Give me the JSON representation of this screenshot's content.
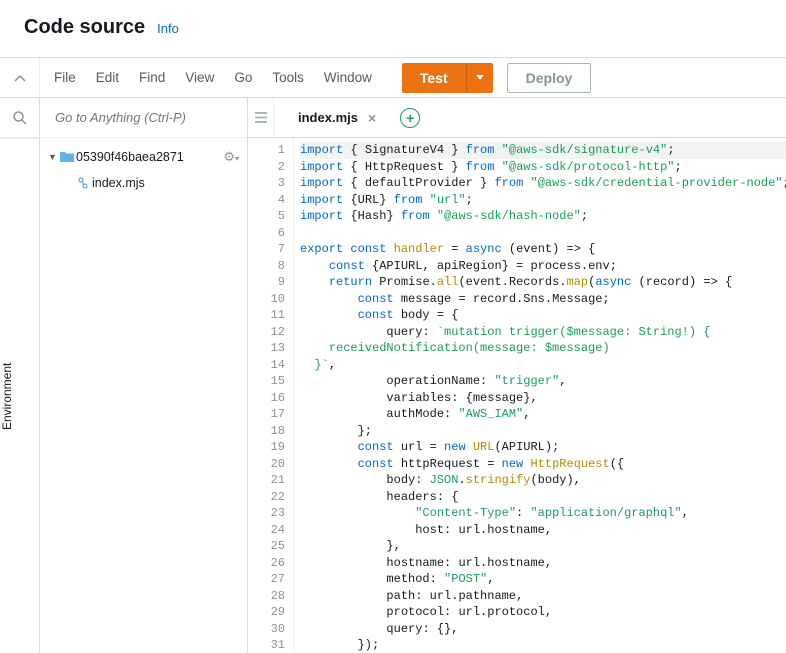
{
  "header": {
    "title": "Code source",
    "info": "Info"
  },
  "menu": {
    "file": "File",
    "edit": "Edit",
    "find": "Find",
    "view": "View",
    "go": "Go",
    "tools": "Tools",
    "window": "Window"
  },
  "buttons": {
    "test": "Test",
    "deploy": "Deploy"
  },
  "rail": {
    "environment": "Environment"
  },
  "search": {
    "placeholder": "Go to Anything (Ctrl-P)"
  },
  "tree": {
    "root": {
      "name": "05390f46baea2871"
    },
    "file": {
      "name": "index.mjs"
    }
  },
  "tab": {
    "name": "index.mjs"
  },
  "code": {
    "lines": [
      [
        [
          "kw",
          "import"
        ],
        [
          "p",
          " { "
        ],
        [
          "v",
          "SignatureV4"
        ],
        [
          "p",
          " } "
        ],
        [
          "kw",
          "from"
        ],
        [
          "p",
          " "
        ],
        [
          "str",
          "\"@aws-sdk/signature-v4\""
        ],
        [
          "p",
          ";"
        ]
      ],
      [
        [
          "kw",
          "import"
        ],
        [
          "p",
          " { "
        ],
        [
          "v",
          "HttpRequest"
        ],
        [
          "p",
          " } "
        ],
        [
          "kw",
          "from"
        ],
        [
          "p",
          " "
        ],
        [
          "str",
          "\"@aws-sdk/protocol-http\""
        ],
        [
          "p",
          ";"
        ]
      ],
      [
        [
          "kw",
          "import"
        ],
        [
          "p",
          " { "
        ],
        [
          "v",
          "defaultProvider"
        ],
        [
          "p",
          " } "
        ],
        [
          "kw",
          "from"
        ],
        [
          "p",
          " "
        ],
        [
          "str",
          "\"@aws-sdk/credential-provider-node\""
        ],
        [
          "p",
          ";"
        ]
      ],
      [
        [
          "kw",
          "import"
        ],
        [
          "p",
          " {"
        ],
        [
          "v",
          "URL"
        ],
        [
          "p",
          "} "
        ],
        [
          "kw",
          "from"
        ],
        [
          "p",
          " "
        ],
        [
          "str",
          "\"url\""
        ],
        [
          "p",
          ";"
        ]
      ],
      [
        [
          "kw",
          "import"
        ],
        [
          "p",
          " {"
        ],
        [
          "v",
          "Hash"
        ],
        [
          "p",
          "} "
        ],
        [
          "kw",
          "from"
        ],
        [
          "p",
          " "
        ],
        [
          "str",
          "\"@aws-sdk/hash-node\""
        ],
        [
          "p",
          ";"
        ]
      ],
      [],
      [
        [
          "kw",
          "export"
        ],
        [
          "p",
          " "
        ],
        [
          "kw",
          "const"
        ],
        [
          "p",
          " "
        ],
        [
          "fn",
          "handler"
        ],
        [
          "p",
          " = "
        ],
        [
          "kw",
          "async"
        ],
        [
          "p",
          " ("
        ],
        [
          "v",
          "event"
        ],
        [
          "p",
          ") => {"
        ]
      ],
      [
        [
          "p",
          "    "
        ],
        [
          "kw",
          "const"
        ],
        [
          "p",
          " {"
        ],
        [
          "v",
          "APIURL"
        ],
        [
          "p",
          ", "
        ],
        [
          "v",
          "apiRegion"
        ],
        [
          "p",
          "} = "
        ],
        [
          "v",
          "process"
        ],
        [
          "p",
          "."
        ],
        [
          "v",
          "env"
        ],
        [
          "p",
          ";"
        ]
      ],
      [
        [
          "p",
          "    "
        ],
        [
          "kw",
          "return"
        ],
        [
          "p",
          " "
        ],
        [
          "v",
          "Promise"
        ],
        [
          "p",
          "."
        ],
        [
          "fn",
          "all"
        ],
        [
          "p",
          "("
        ],
        [
          "v",
          "event"
        ],
        [
          "p",
          "."
        ],
        [
          "v",
          "Records"
        ],
        [
          "p",
          "."
        ],
        [
          "fn",
          "map"
        ],
        [
          "p",
          "("
        ],
        [
          "kw",
          "async"
        ],
        [
          "p",
          " ("
        ],
        [
          "v",
          "record"
        ],
        [
          "p",
          ") => {"
        ]
      ],
      [
        [
          "p",
          "        "
        ],
        [
          "kw",
          "const"
        ],
        [
          "p",
          " "
        ],
        [
          "v",
          "message"
        ],
        [
          "p",
          " = "
        ],
        [
          "v",
          "record"
        ],
        [
          "p",
          "."
        ],
        [
          "v",
          "Sns"
        ],
        [
          "p",
          "."
        ],
        [
          "v",
          "Message"
        ],
        [
          "p",
          ";"
        ]
      ],
      [
        [
          "p",
          "        "
        ],
        [
          "kw",
          "const"
        ],
        [
          "p",
          " "
        ],
        [
          "v",
          "body"
        ],
        [
          "p",
          " = {"
        ]
      ],
      [
        [
          "p",
          "            "
        ],
        [
          "v",
          "query"
        ],
        [
          "p",
          ": "
        ],
        [
          "str",
          "`mutation trigger($message: String!) {"
        ]
      ],
      [
        [
          "p",
          "    "
        ],
        [
          "str",
          "receivedNotification(message: $message)"
        ]
      ],
      [
        [
          "str",
          "  }`"
        ],
        [
          "p",
          ","
        ]
      ],
      [
        [
          "p",
          "            "
        ],
        [
          "v",
          "operationName"
        ],
        [
          "p",
          ": "
        ],
        [
          "str",
          "\"trigger\""
        ],
        [
          "p",
          ","
        ]
      ],
      [
        [
          "p",
          "            "
        ],
        [
          "v",
          "variables"
        ],
        [
          "p",
          ": {"
        ],
        [
          "v",
          "message"
        ],
        [
          "p",
          "},"
        ]
      ],
      [
        [
          "p",
          "            "
        ],
        [
          "v",
          "authMode"
        ],
        [
          "p",
          ": "
        ],
        [
          "str",
          "\"AWS_IAM\""
        ],
        [
          "p",
          ","
        ]
      ],
      [
        [
          "p",
          "        };"
        ]
      ],
      [
        [
          "p",
          "        "
        ],
        [
          "kw",
          "const"
        ],
        [
          "p",
          " "
        ],
        [
          "v",
          "url"
        ],
        [
          "p",
          " = "
        ],
        [
          "kw",
          "new"
        ],
        [
          "p",
          " "
        ],
        [
          "fn",
          "URL"
        ],
        [
          "p",
          "("
        ],
        [
          "v",
          "APIURL"
        ],
        [
          "p",
          ");"
        ]
      ],
      [
        [
          "p",
          "        "
        ],
        [
          "kw",
          "const"
        ],
        [
          "p",
          " "
        ],
        [
          "v",
          "httpRequest"
        ],
        [
          "p",
          " = "
        ],
        [
          "kw",
          "new"
        ],
        [
          "p",
          " "
        ],
        [
          "fn",
          "HttpRequest"
        ],
        [
          "p",
          "({"
        ]
      ],
      [
        [
          "p",
          "            "
        ],
        [
          "v",
          "body"
        ],
        [
          "p",
          ": "
        ],
        [
          "type",
          "JSON"
        ],
        [
          "p",
          "."
        ],
        [
          "fn",
          "stringify"
        ],
        [
          "p",
          "("
        ],
        [
          "v",
          "body"
        ],
        [
          "p",
          "),"
        ]
      ],
      [
        [
          "p",
          "            "
        ],
        [
          "v",
          "headers"
        ],
        [
          "p",
          ": {"
        ]
      ],
      [
        [
          "p",
          "                "
        ],
        [
          "str",
          "\"Content-Type\""
        ],
        [
          "p",
          ": "
        ],
        [
          "str",
          "\"application/graphql\""
        ],
        [
          "p",
          ","
        ]
      ],
      [
        [
          "p",
          "                "
        ],
        [
          "v",
          "host"
        ],
        [
          "p",
          ": "
        ],
        [
          "v",
          "url"
        ],
        [
          "p",
          "."
        ],
        [
          "v",
          "hostname"
        ],
        [
          "p",
          ","
        ]
      ],
      [
        [
          "p",
          "            },"
        ]
      ],
      [
        [
          "p",
          "            "
        ],
        [
          "v",
          "hostname"
        ],
        [
          "p",
          ": "
        ],
        [
          "v",
          "url"
        ],
        [
          "p",
          "."
        ],
        [
          "v",
          "hostname"
        ],
        [
          "p",
          ","
        ]
      ],
      [
        [
          "p",
          "            "
        ],
        [
          "v",
          "method"
        ],
        [
          "p",
          ": "
        ],
        [
          "str",
          "\"POST\""
        ],
        [
          "p",
          ","
        ]
      ],
      [
        [
          "p",
          "            "
        ],
        [
          "v",
          "path"
        ],
        [
          "p",
          ": "
        ],
        [
          "v",
          "url"
        ],
        [
          "p",
          "."
        ],
        [
          "v",
          "pathname"
        ],
        [
          "p",
          ","
        ]
      ],
      [
        [
          "p",
          "            "
        ],
        [
          "v",
          "protocol"
        ],
        [
          "p",
          ": "
        ],
        [
          "v",
          "url"
        ],
        [
          "p",
          "."
        ],
        [
          "v",
          "protocol"
        ],
        [
          "p",
          ","
        ]
      ],
      [
        [
          "p",
          "            "
        ],
        [
          "v",
          "query"
        ],
        [
          "p",
          ": {},"
        ]
      ],
      [
        [
          "p",
          "        });"
        ]
      ]
    ]
  }
}
